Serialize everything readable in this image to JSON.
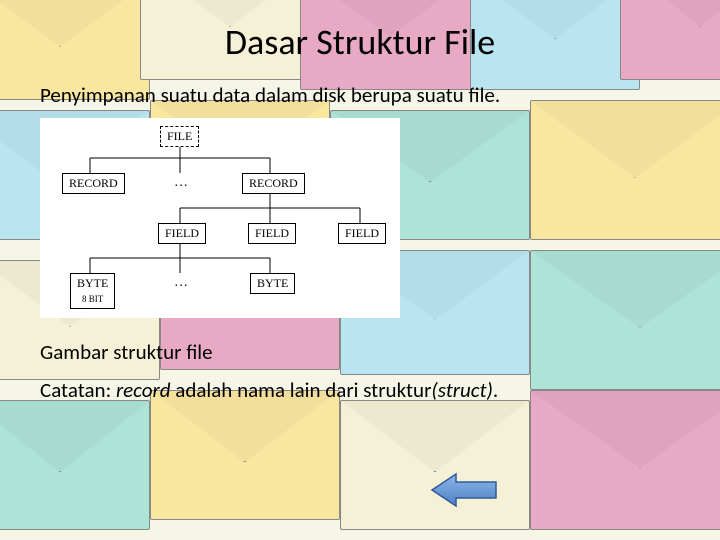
{
  "title": "Dasar Struktur File",
  "subtitle": "Penyimpanan suatu data dalam disk berupa suatu file.",
  "diagram": {
    "file": "FILE",
    "record": "RECORD",
    "field": "FIELD",
    "byte": "BYTE",
    "byte_note": "8 BIT",
    "ellipsis": "…"
  },
  "caption_line1": "Gambar struktur file",
  "caption_prefix": "Catatan: ",
  "caption_italic1": "record",
  "caption_mid": " adalah nama lain dari struktur",
  "caption_italic2": "(struct)",
  "caption_end": "."
}
